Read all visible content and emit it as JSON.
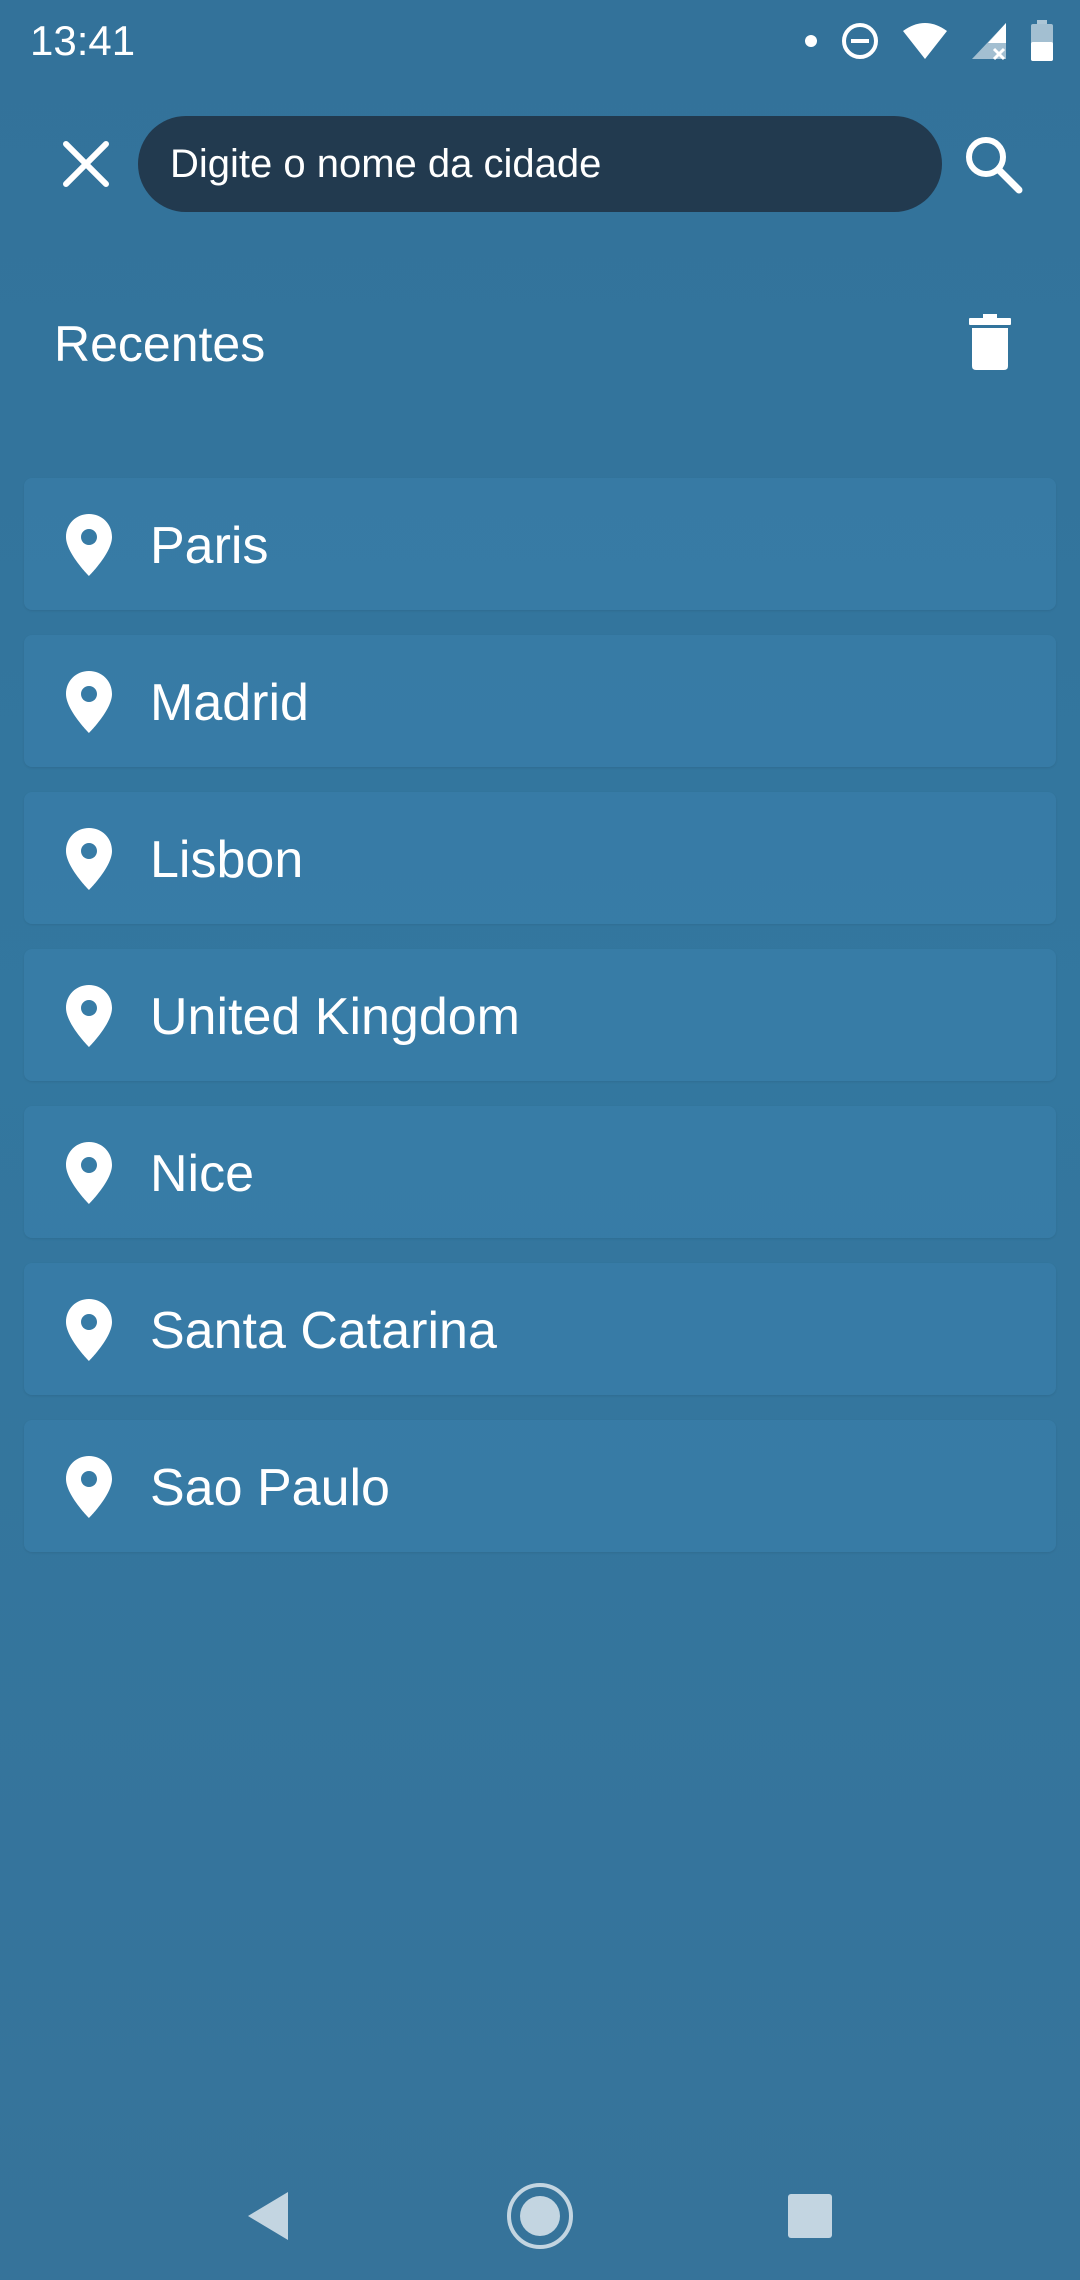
{
  "status_bar": {
    "time": "13:41",
    "icons": [
      "notification-dot-icon",
      "do-not-disturb-icon",
      "wifi-icon",
      "cell-signal-icon",
      "battery-icon"
    ]
  },
  "search": {
    "placeholder": "Digite o nome da cidade",
    "value": "",
    "close_icon": "close-icon",
    "search_icon": "search-icon"
  },
  "recents": {
    "title": "Recentes",
    "clear_icon": "trash-icon",
    "items": [
      {
        "name": "Paris",
        "icon": "location-pin-icon"
      },
      {
        "name": "Madrid",
        "icon": "location-pin-icon"
      },
      {
        "name": "Lisbon",
        "icon": "location-pin-icon"
      },
      {
        "name": "United Kingdom",
        "icon": "location-pin-icon"
      },
      {
        "name": "Nice",
        "icon": "location-pin-icon"
      },
      {
        "name": "Santa Catarina",
        "icon": "location-pin-icon"
      },
      {
        "name": "Sao Paulo",
        "icon": "location-pin-icon"
      }
    ]
  },
  "nav_bar": {
    "buttons": [
      "back-icon",
      "home-icon",
      "recents-icon"
    ]
  },
  "colors": {
    "background": "#34739a",
    "search_field": "#223a4f",
    "list_item": "#3a80ad",
    "text": "#ffffff"
  }
}
